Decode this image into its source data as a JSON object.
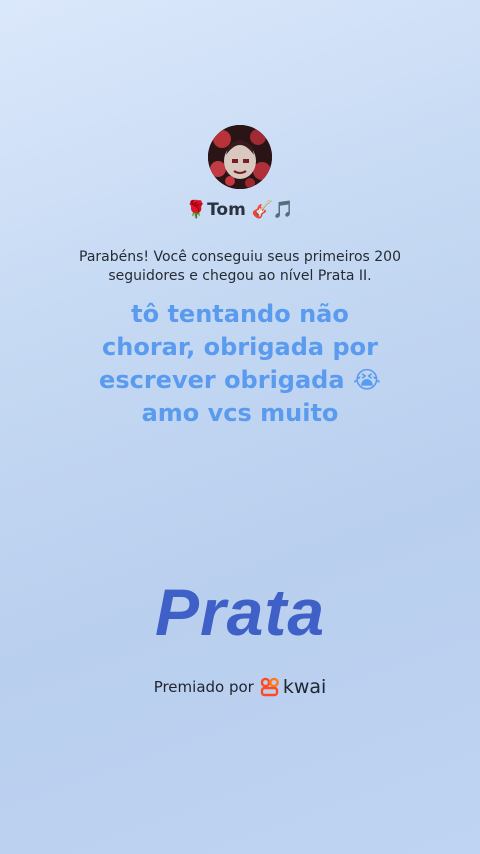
{
  "profile": {
    "username": "🌹Tom 🎸🎵"
  },
  "achievement": {
    "description": "Parabéns! Você conseguiu seus primeiros 200 seguidores e chegou ao nível Prata II.",
    "level_name": "Prata",
    "award_label": "Premiado por",
    "brand_name": "kwai"
  },
  "overlay_text": {
    "line1": "tô tentando não",
    "line2": "chorar, obrigada por",
    "line3": "escrever obrigada 😭",
    "line4": "amo vcs muito"
  },
  "colors": {
    "overlay_text": "#5a9bef",
    "level_name": "#3f60c7",
    "brand_logo": "#ff4a1f"
  },
  "icons": [
    "avatar-image",
    "kwai-logo-icon"
  ]
}
